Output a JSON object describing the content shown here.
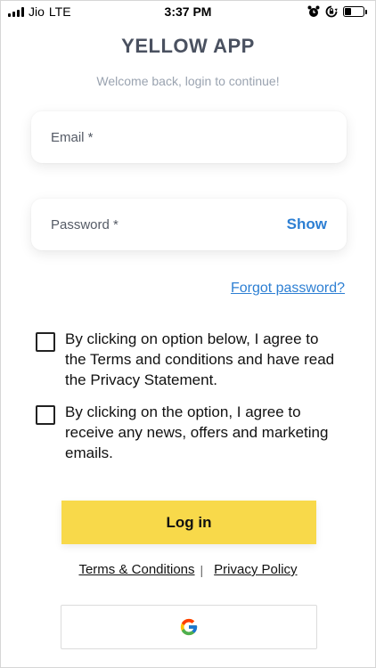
{
  "status_bar": {
    "carrier": "Jio",
    "network": "LTE",
    "time": "3:37 PM",
    "icons": [
      "signal-icon",
      "alarm-icon",
      "rotation-lock-icon",
      "battery-icon"
    ]
  },
  "header": {
    "title": "YELLOW APP",
    "subtitle": "Welcome back, login to continue!"
  },
  "form": {
    "email_placeholder": "Email *",
    "password_placeholder": "Password *",
    "show_label": "Show",
    "forgot_label": "Forgot password?"
  },
  "consents": [
    {
      "text": "By clicking on option below, I agree to the Terms and conditions and have read the Privacy Statement.",
      "checked": false
    },
    {
      "text": "By clicking on the option, I agree to receive any news, offers and marketing emails.",
      "checked": false
    }
  ],
  "actions": {
    "login_label": "Log in",
    "terms_label": "Terms & Conditions",
    "separator": "|",
    "privacy_label": "Privacy Policy",
    "google_icon": "google-icon"
  },
  "colors": {
    "accent_yellow": "#f8d94a",
    "link_blue": "#2d7fd3",
    "title_gray": "#4a5160",
    "subtitle_gray": "#9aa3b0"
  }
}
